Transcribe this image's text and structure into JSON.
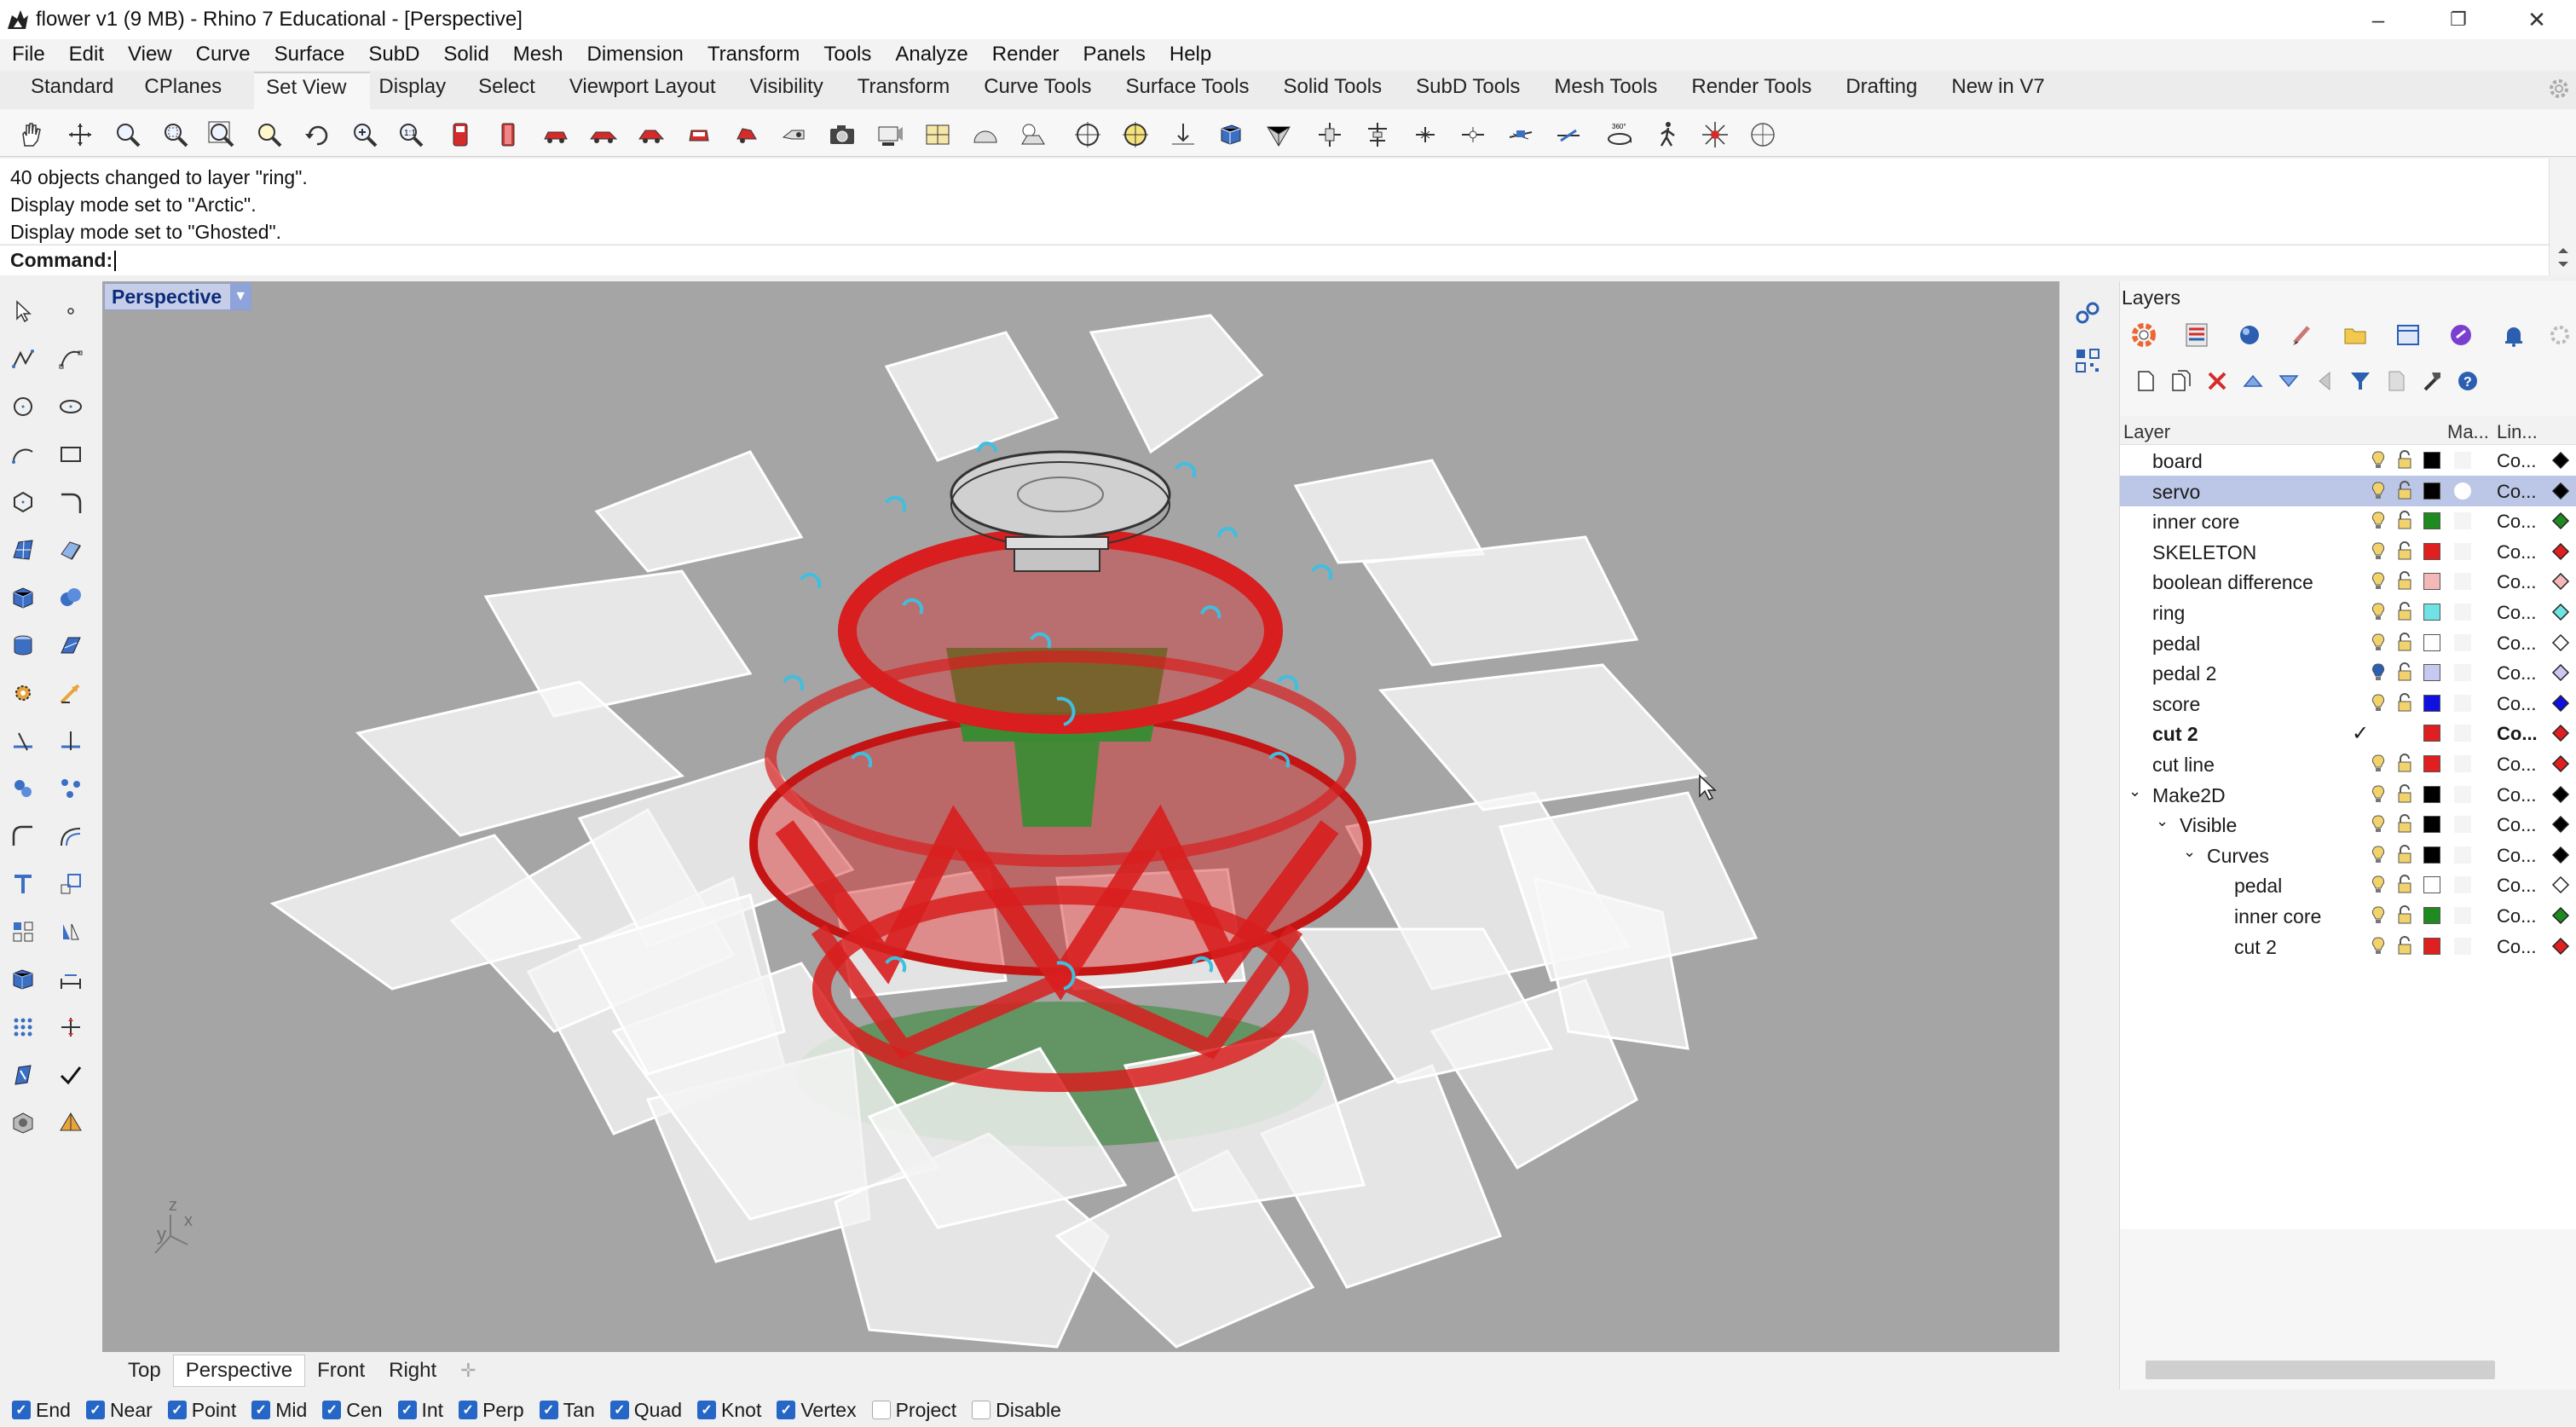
{
  "window": {
    "title": "flower v1 (9 MB) - Rhino 7 Educational - [Perspective]",
    "minimize": "–",
    "maximize": "❐",
    "close": "✕"
  },
  "menu": [
    "File",
    "Edit",
    "View",
    "Curve",
    "Surface",
    "SubD",
    "Solid",
    "Mesh",
    "Dimension",
    "Transform",
    "Tools",
    "Analyze",
    "Render",
    "Panels",
    "Help"
  ],
  "toolbar_tabs": [
    "Standard",
    "CPlanes",
    "Set View",
    "Display",
    "Select",
    "Viewport Layout",
    "Visibility",
    "Transform",
    "Curve Tools",
    "Surface Tools",
    "Solid Tools",
    "SubD Tools",
    "Mesh Tools",
    "Render Tools",
    "Drafting",
    "New in V7"
  ],
  "active_toolbar_tab": "Set View",
  "command_history": [
    "40 objects changed to layer \"ring\".",
    "Display mode set to \"Arctic\".",
    "Display mode set to \"Ghosted\"."
  ],
  "command_label": "Command:",
  "viewport": {
    "name": "Perspective",
    "axis_labels": {
      "x": "x",
      "y": "y",
      "z": "z"
    }
  },
  "viewport_tabs": [
    "Top",
    "Perspective",
    "Front",
    "Right"
  ],
  "active_viewport_tab": "Perspective",
  "osnaps": [
    {
      "label": "End",
      "checked": true
    },
    {
      "label": "Near",
      "checked": true
    },
    {
      "label": "Point",
      "checked": true
    },
    {
      "label": "Mid",
      "checked": true
    },
    {
      "label": "Cen",
      "checked": true
    },
    {
      "label": "Int",
      "checked": true
    },
    {
      "label": "Perp",
      "checked": true
    },
    {
      "label": "Tan",
      "checked": true
    },
    {
      "label": "Quad",
      "checked": true
    },
    {
      "label": "Knot",
      "checked": true
    },
    {
      "label": "Vertex",
      "checked": true
    },
    {
      "label": "Project",
      "checked": false
    },
    {
      "label": "Disable",
      "checked": false
    }
  ],
  "layers_panel": {
    "title": "Layers",
    "columns": {
      "layer": "Layer",
      "material": "Ma...",
      "linetype": "Lin..."
    },
    "rows": [
      {
        "name": "board",
        "indent": 0,
        "color": "#000000",
        "linetype": "Co...",
        "selected": false,
        "current": false
      },
      {
        "name": "servo",
        "indent": 0,
        "color": "#000000",
        "linetype": "Co...",
        "selected": true,
        "current": false
      },
      {
        "name": "inner core",
        "indent": 0,
        "color": "#1f8a1f",
        "linetype": "Co...",
        "selected": false,
        "current": false
      },
      {
        "name": "SKELETON",
        "indent": 0,
        "color": "#e02020",
        "linetype": "Co...",
        "selected": false,
        "current": false
      },
      {
        "name": "boolean difference",
        "indent": 0,
        "color": "#f5b8b8",
        "linetype": "Co...",
        "selected": false,
        "current": false
      },
      {
        "name": "ring",
        "indent": 0,
        "color": "#6fe3e3",
        "linetype": "Co...",
        "selected": false,
        "current": false
      },
      {
        "name": "pedal",
        "indent": 0,
        "color": "#ffffff",
        "linetype": "Co...",
        "selected": false,
        "current": false
      },
      {
        "name": "pedal 2",
        "indent": 0,
        "color": "#c8c8f0",
        "linetype": "Co...",
        "selected": false,
        "current": false
      },
      {
        "name": "score",
        "indent": 0,
        "color": "#1010e0",
        "linetype": "Co...",
        "selected": false,
        "current": false
      },
      {
        "name": "cut 2",
        "indent": 0,
        "color": "#e02020",
        "linetype": "Co...",
        "selected": false,
        "current": true
      },
      {
        "name": "cut line",
        "indent": 0,
        "color": "#e02020",
        "linetype": "Co...",
        "selected": false,
        "current": false
      },
      {
        "name": "Make2D",
        "indent": 0,
        "color": "#000000",
        "linetype": "Co...",
        "selected": false,
        "current": false,
        "expandable": true
      },
      {
        "name": "Visible",
        "indent": 1,
        "color": "#000000",
        "linetype": "Co...",
        "selected": false,
        "current": false,
        "expandable": true
      },
      {
        "name": "Curves",
        "indent": 2,
        "color": "#000000",
        "linetype": "Co...",
        "selected": false,
        "current": false,
        "expandable": true
      },
      {
        "name": "pedal",
        "indent": 3,
        "color": "#ffffff",
        "linetype": "Co...",
        "selected": false,
        "current": false
      },
      {
        "name": "inner core",
        "indent": 3,
        "color": "#1f8a1f",
        "linetype": "Co...",
        "selected": false,
        "current": false
      },
      {
        "name": "cut 2",
        "indent": 3,
        "color": "#e02020",
        "linetype": "Co...",
        "selected": false,
        "current": false
      }
    ]
  },
  "colors": {
    "viewport_bg": "#a5a5a5",
    "selection": "#bcc6e6",
    "accent_blue": "#2566c7",
    "model_red": "#d81e1e",
    "model_green": "#2f8f2f",
    "petal_white": "#f4f4f4"
  }
}
